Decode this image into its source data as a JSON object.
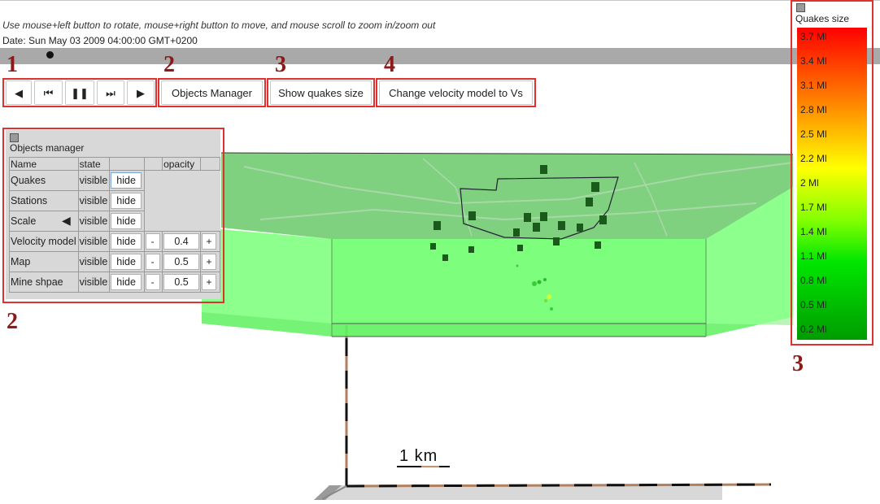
{
  "instructions": "Use mouse+left button to rotate, mouse+right button to move, and mouse scroll to zoom in/zoom out",
  "date": "Date: Sun May 03 2009 04:00:00 GMT+0200",
  "annotations": {
    "n1": "1",
    "n2": "2",
    "n3": "3",
    "n4": "4",
    "n2b": "2",
    "n3b": "3"
  },
  "controls": {
    "prev_icon": "triangle-left-icon",
    "first_icon": "skip-back-icon",
    "pause_icon": "pause-icon",
    "last_icon": "skip-forward-icon",
    "next_icon": "triangle-right-icon",
    "objects_manager": "Objects Manager",
    "show_quakes_size": "Show quakes size",
    "change_velocity": "Change velocity model to Vs"
  },
  "objects_manager": {
    "title": "Objects manager",
    "headers": {
      "name": "Name",
      "state": "state",
      "opacity": "opacity"
    },
    "rows": [
      {
        "name": "Quakes",
        "state": "visible",
        "button": "hide"
      },
      {
        "name": "Stations",
        "state": "visible",
        "button": "hide"
      },
      {
        "name": "Scale",
        "state": "visible",
        "button": "hide"
      },
      {
        "name": "Velocity model",
        "state": "visible",
        "button": "hide",
        "minus": "-",
        "opacity": "0.4",
        "plus": "+"
      },
      {
        "name": "Map",
        "state": "visible",
        "button": "hide",
        "minus": "-",
        "opacity": "0.5",
        "plus": "+"
      },
      {
        "name": "Mine shpae",
        "state": "visible",
        "button": "hide",
        "minus": "-",
        "opacity": "0.5",
        "plus": "+"
      }
    ]
  },
  "legend": {
    "title": "Quakes size",
    "labels": [
      "3.7 Ml",
      "3.4 Ml",
      "3.1 Ml",
      "2.8 Ml",
      "2.5 Ml",
      "2.2 Ml",
      "2 Ml",
      "1.7 Ml",
      "1.4 Ml",
      "1.1 Ml",
      "0.8 Ml",
      "0.5 Ml",
      "0.2 Ml"
    ]
  },
  "scale_label": "1 km",
  "colors": {
    "annotation": "#8b1a1a",
    "highlight": "#e03131",
    "volume": "#66ff66",
    "map": "#7fd17f"
  }
}
